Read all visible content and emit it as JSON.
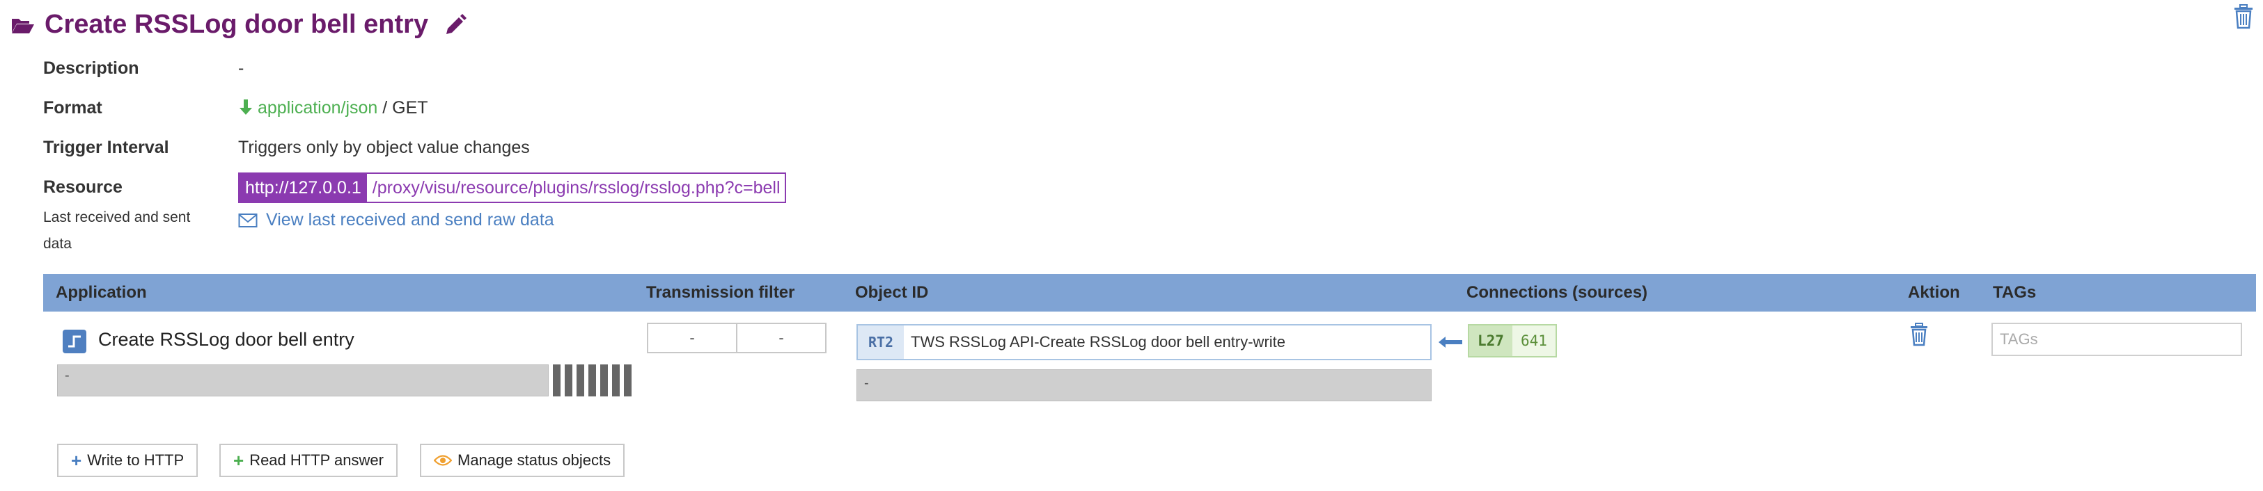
{
  "header": {
    "title": "Create RSSLog door bell entry"
  },
  "info": {
    "description_label": "Description",
    "description_value": "-",
    "format_label": "Format",
    "format_type": "application/json",
    "format_method": " / GET",
    "trigger_label": "Trigger Interval",
    "trigger_value": "Triggers only by object value changes",
    "resource_label": "Resource",
    "resource_host": "http://127.0.0.1",
    "resource_path": "/proxy/visu/resource/plugins/rsslog/rsslog.php?c=bell",
    "last_received_label": "Last received and sent data",
    "raw_data_link": "View last received and send raw data"
  },
  "table": {
    "headers": {
      "application": "Application",
      "transmission_filter": "Transmission filter",
      "object_id": "Object ID",
      "connections": "Connections (sources)",
      "aktion": "Aktion",
      "tags": "TAGs"
    },
    "row": {
      "app_name": "Create RSSLog door bell entry",
      "app_status": "-",
      "filter_left": "-",
      "filter_right": "-",
      "object_type": "RT2",
      "object_name": "TWS RSSLog API-Create RSSLog door bell entry-write",
      "object_status": "-",
      "connection_id": "L27",
      "connection_value": "641",
      "tags_placeholder": "TAGs"
    }
  },
  "buttons": {
    "write_http": "Write to HTTP",
    "read_http": "Read HTTP answer",
    "manage_status": "Manage status objects"
  },
  "colors": {
    "title": "#6a1b6a",
    "header_bg": "#7fa3d4",
    "resource_accent": "#8b3ab0",
    "link": "#4a7fc1",
    "green": "#4caf50"
  }
}
